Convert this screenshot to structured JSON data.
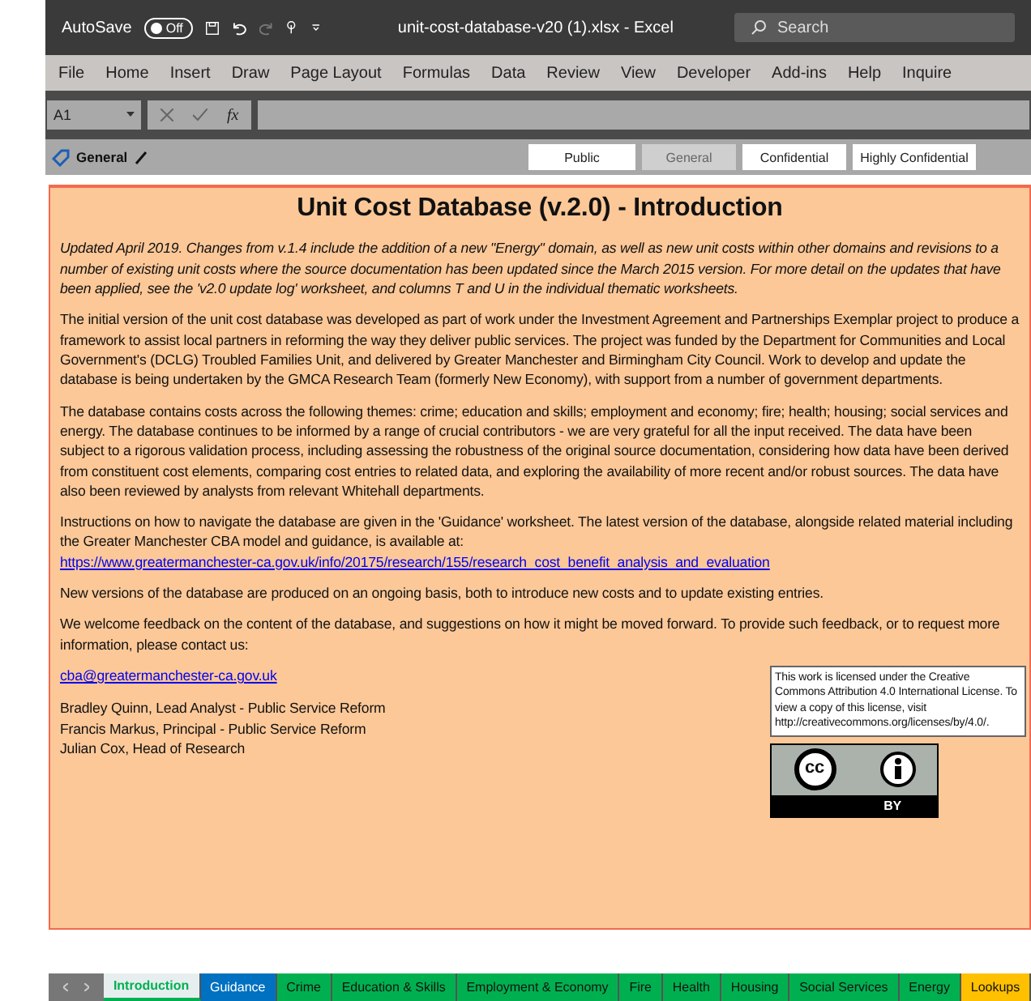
{
  "title_bar": {
    "autosave_label": "AutoSave",
    "autosave_toggle": {
      "label": "Off",
      "on": false
    },
    "document_title": "unit-cost-database-v20 (1).xlsx  -  Excel",
    "search": {
      "placeholder": "Search"
    }
  },
  "menu": [
    {
      "label": "File"
    },
    {
      "label": "Home"
    },
    {
      "label": "Insert"
    },
    {
      "label": "Draw"
    },
    {
      "label": "Page Layout"
    },
    {
      "label": "Formulas"
    },
    {
      "label": "Data"
    },
    {
      "label": "Review"
    },
    {
      "label": "View"
    },
    {
      "label": "Developer"
    },
    {
      "label": "Add-ins"
    },
    {
      "label": "Help"
    },
    {
      "label": "Inquire"
    }
  ],
  "formula_bar": {
    "name_box": "A1",
    "fx": "fx"
  },
  "classification_bar": {
    "current": "General",
    "options": [
      {
        "label": "Public",
        "selected": false
      },
      {
        "label": "General",
        "selected": true
      },
      {
        "label": "Confidential",
        "selected": false
      },
      {
        "label": "Highly Confidential",
        "selected": false
      }
    ]
  },
  "sheet": {
    "title": "Unit Cost Database (v.2.0) - Introduction",
    "paragraphs": [
      {
        "kind": "italic",
        "text": "Updated April 2019.  Changes from v.1.4 include the addition of a new \"Energy\" domain, as well as new unit costs within other domains and revisions to a number of existing unit costs where the source documentation has been updated since the March 2015 version.  For more detail on the updates that have been applied, see the 'v2.0 update log' worksheet, and columns T and U in the individual thematic worksheets."
      },
      {
        "kind": "plain",
        "text": "The initial version of the unit cost database was developed as part of work under the Investment Agreement and Partnerships Exemplar project to produce a framework to assist local partners in reforming the way they deliver public services.  The project was funded by the Department for Communities and Local Government's (DCLG) Troubled Families Unit, and delivered by Greater Manchester and Birmingham City Council.  Work to develop and update the database is being undertaken by the GMCA Research Team (formerly New Economy), with support from a number of government departments."
      },
      {
        "kind": "plain",
        "text": "The database contains costs across the following themes: crime; education and skills; employment and economy; fire; health; housing; social services and energy.  The database continues to be informed by a range of crucial contributors - we are very grateful for all the input received.  The data have been subject to a rigorous validation process, including assessing the robustness of the original source documentation, considering how data have been derived from constituent cost elements, comparing cost entries to related data, and exploring the availability of more recent and/or robust sources.  The data have also been reviewed by analysts from relevant Whitehall departments."
      },
      {
        "kind": "plain",
        "text": "Instructions on how to navigate the database are given in the 'Guidance' worksheet.  The latest version of the database, alongside related material including the Greater Manchester CBA model and guidance, is available at:"
      },
      {
        "kind": "link",
        "text": "https://www.greatermanchester-ca.gov.uk/info/20175/research/155/research_cost_benefit_analysis_and_evaluation"
      },
      {
        "kind": "plain",
        "text": "New versions of the database are produced on an ongoing basis, both to introduce new costs and to update existing entries."
      },
      {
        "kind": "plain",
        "text": "We welcome feedback on the content of the database, and suggestions on how it might be moved forward.  To provide such feedback, or to request more information, please contact us:"
      }
    ],
    "email": "cba@greatermanchester-ca.gov.uk",
    "contacts": [
      "Bradley Quinn, Lead Analyst - Public Service Reform",
      "Francis Markus, Principal - Public Service Reform",
      "Julian Cox, Head of Research"
    ],
    "license_text": "This work is licensed under the Creative Commons Attribution 4.0 International License. To view a copy of this license, visit http://creativecommons.org/licenses/by/4.0/.",
    "license_badge": {
      "cc": "cc",
      "by": "BY"
    }
  },
  "sheet_tabs": [
    {
      "label": "Introduction",
      "selected": true,
      "color": "#00b050"
    },
    {
      "label": "Guidance",
      "selected": false,
      "color": "#0070c0"
    },
    {
      "label": "Crime",
      "selected": false,
      "color": "#00b050"
    },
    {
      "label": "Education & Skills",
      "selected": false,
      "color": "#00b050"
    },
    {
      "label": "Employment & Economy",
      "selected": false,
      "color": "#00b050"
    },
    {
      "label": "Fire",
      "selected": false,
      "color": "#00b050"
    },
    {
      "label": "Health",
      "selected": false,
      "color": "#00b050"
    },
    {
      "label": "Housing",
      "selected": false,
      "color": "#00b050"
    },
    {
      "label": "Social Services",
      "selected": false,
      "color": "#00b050"
    },
    {
      "label": "Energy",
      "selected": false,
      "color": "#00b050"
    },
    {
      "label": "Lookups",
      "selected": false,
      "color": "#ffc000"
    }
  ]
}
